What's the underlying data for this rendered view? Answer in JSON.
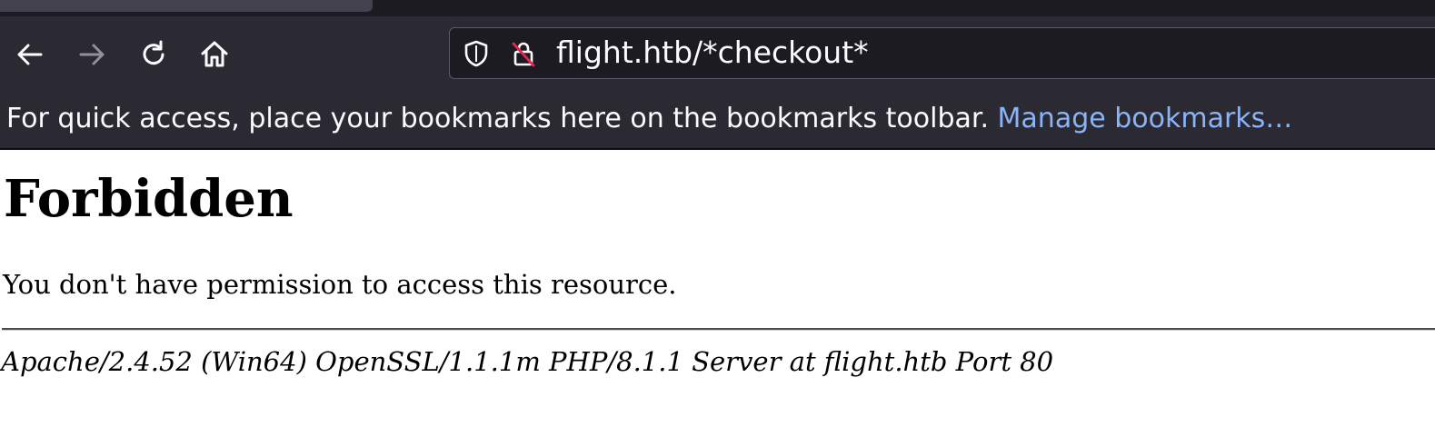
{
  "browser": {
    "address_bar": {
      "url": "flight.htb/*checkout*",
      "icons": [
        "shield-icon",
        "insecure-lock-icon"
      ]
    },
    "nav_icons": [
      "back-arrow-icon",
      "forward-arrow-icon",
      "reload-icon",
      "home-icon"
    ],
    "bookmarks_toolbar": {
      "message": "For quick access, place your bookmarks here on the bookmarks toolbar.",
      "link": "Manage bookmarks…"
    },
    "colors": {
      "chrome_bg": "#2b2a33",
      "tabstrip_bg": "#1c1b22",
      "link": "#8ab4f8",
      "text_light": "#fbfbfe"
    }
  },
  "page": {
    "heading": "Forbidden",
    "message": "You don't have permission to access this resource.",
    "server_signature": "Apache/2.4.52 (Win64) OpenSSL/1.1.1m PHP/8.1.1 Server at flight.htb Port 80"
  }
}
